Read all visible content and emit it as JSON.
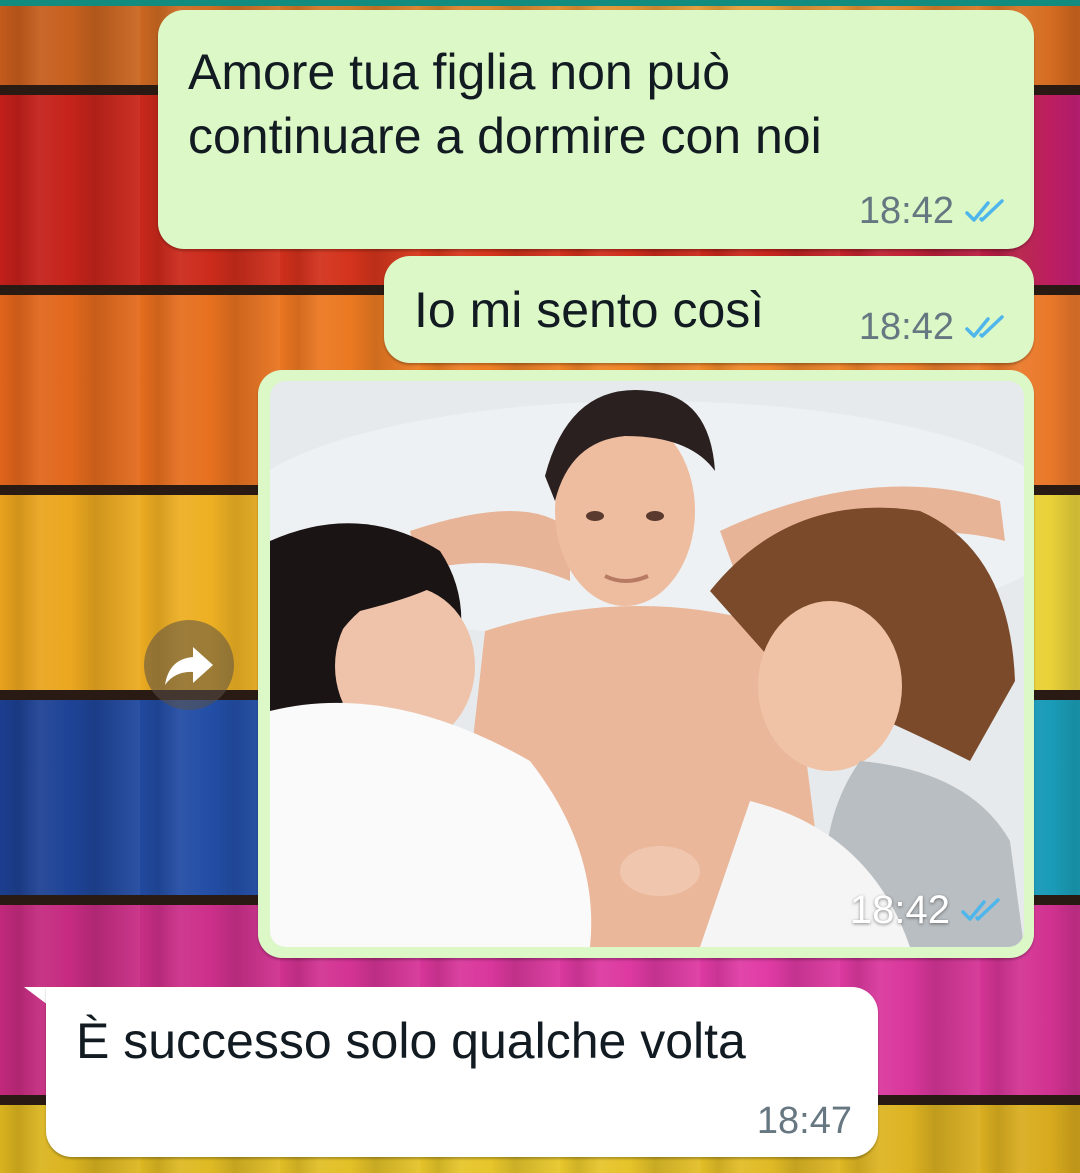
{
  "colors": {
    "outgoing_bubble": "#dcf8c6",
    "incoming_bubble": "#ffffff",
    "read_ticks": "#4fb6ec",
    "timestamp": "#667781",
    "header_accent": "#128c7e"
  },
  "messages": [
    {
      "direction": "outgoing",
      "text": "Amore tua figlia non può\ncontinuare a dormire con noi",
      "time": "18:42",
      "status_icon": "double-check-read"
    },
    {
      "direction": "outgoing",
      "text": "Io mi sento così",
      "time": "18:42",
      "status_icon": "double-check-read"
    },
    {
      "direction": "outgoing",
      "type": "image",
      "time": "18:42",
      "status_icon": "double-check-read",
      "forward_icon": "forward-arrow-icon"
    },
    {
      "direction": "incoming",
      "text": "È successo solo qualche volta",
      "time": "18:47"
    }
  ]
}
